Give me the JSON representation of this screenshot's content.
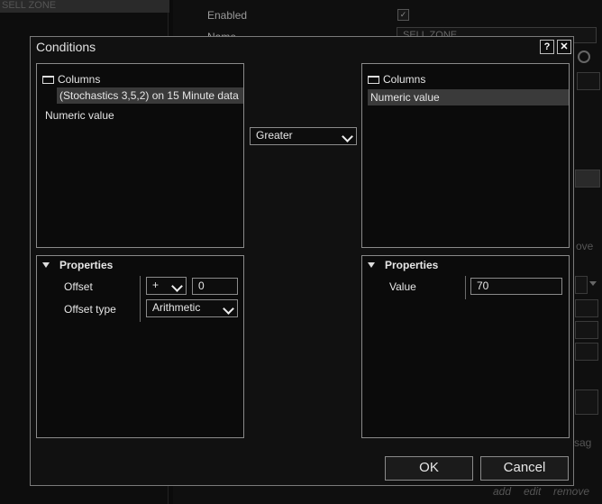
{
  "background": {
    "list_item": "SELL ZONE",
    "enabled_label": "Enabled",
    "name_label": "Name",
    "name_value": "SELL ZONE",
    "faded_ove": "ove",
    "faded_sag": "sag",
    "link_add": "add",
    "link_edit": "edit",
    "link_remove": "remove"
  },
  "dialog": {
    "title": "Conditions",
    "help_button": "?",
    "close_button": "✕",
    "left_panel": {
      "header": "Columns",
      "items": [
        "(Stochastics 3,5,2) on 15 Minute data",
        "Numeric value"
      ],
      "selected_index": 0
    },
    "operator": {
      "value": "Greater"
    },
    "right_panel": {
      "header": "Columns",
      "items": [
        "Numeric value"
      ],
      "selected_index": 0
    },
    "left_properties": {
      "title": "Properties",
      "offset_label": "Offset",
      "offset_sign": "+",
      "offset_value": "0",
      "offset_type_label": "Offset type",
      "offset_type_value": "Arithmetic"
    },
    "right_properties": {
      "title": "Properties",
      "value_label": "Value",
      "value": "70"
    },
    "ok_label": "OK",
    "cancel_label": "Cancel"
  },
  "colors": {
    "background": "#0b0b0b",
    "border": "#8a8a8a",
    "selection": "#3a3a3a",
    "text": "#e6e6e6"
  }
}
